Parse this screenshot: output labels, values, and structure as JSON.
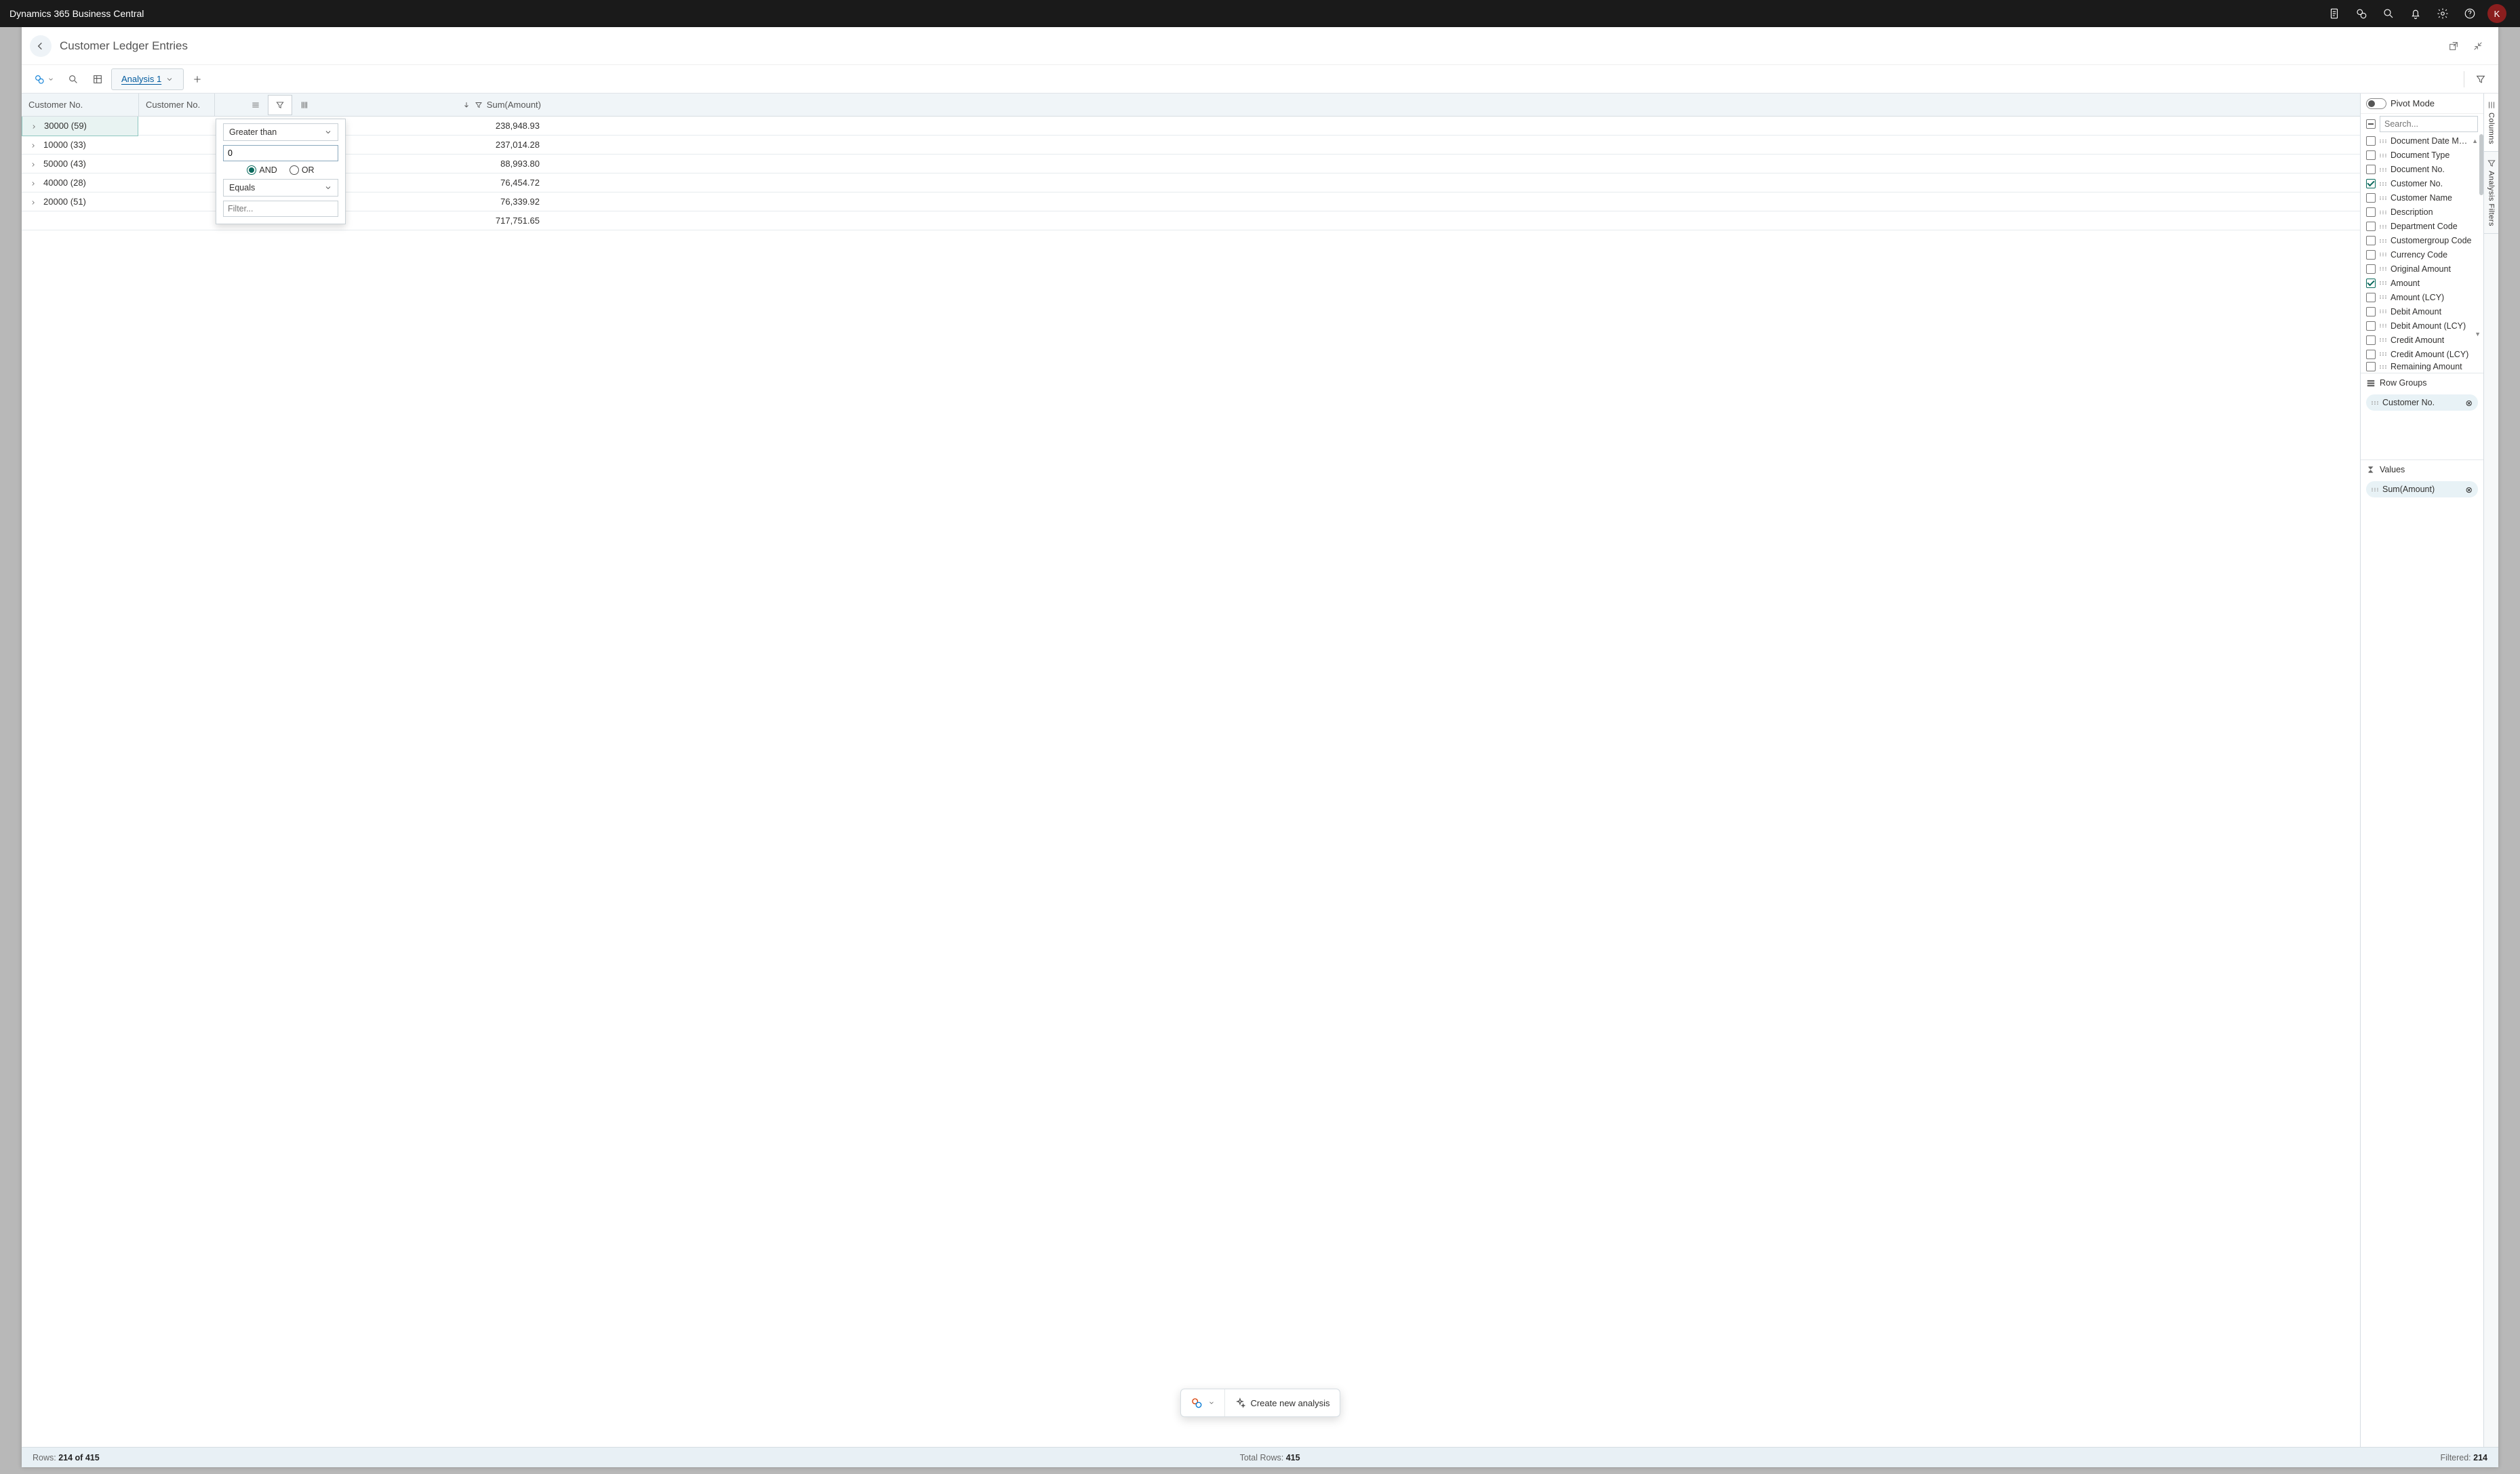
{
  "topbar": {
    "title": "Dynamics 365 Business Central",
    "avatar": "K"
  },
  "page": {
    "title": "Customer Ledger Entries",
    "tab_label": "Analysis 1"
  },
  "grid": {
    "col_customer_no": "Customer No.",
    "col_customer_no2": "Customer No.",
    "col_amount": "Sum(Amount)",
    "rows": [
      {
        "group": "30000",
        "count": "(59)",
        "amount": "238,948.93",
        "selected": true
      },
      {
        "group": "10000",
        "count": "(33)",
        "amount": "237,014.28"
      },
      {
        "group": "50000",
        "count": "(43)",
        "amount": "88,993.80"
      },
      {
        "group": "40000",
        "count": "(28)",
        "amount": "76,454.72"
      },
      {
        "group": "20000",
        "count": "(51)",
        "amount": "76,339.92"
      }
    ],
    "total": "717,751.65"
  },
  "filter_popup": {
    "op1": "Greater than",
    "value1": "0",
    "and": "AND",
    "or": "OR",
    "op2": "Equals",
    "value2_placeholder": "Filter..."
  },
  "side": {
    "pivot_mode": "Pivot Mode",
    "search_placeholder": "Search...",
    "columns": [
      {
        "label": "Document Date Month",
        "checked": false,
        "sort": "▲"
      },
      {
        "label": "Document Type",
        "checked": false
      },
      {
        "label": "Document No.",
        "checked": false
      },
      {
        "label": "Customer No.",
        "checked": true
      },
      {
        "label": "Customer Name",
        "checked": false
      },
      {
        "label": "Description",
        "checked": false
      },
      {
        "label": "Department Code",
        "checked": false
      },
      {
        "label": "Customergroup Code",
        "checked": false
      },
      {
        "label": "Currency Code",
        "checked": false
      },
      {
        "label": "Original Amount",
        "checked": false
      },
      {
        "label": "Amount",
        "checked": true
      },
      {
        "label": "Amount (LCY)",
        "checked": false
      },
      {
        "label": "Debit Amount",
        "checked": false
      },
      {
        "label": "Debit Amount (LCY)",
        "checked": false
      },
      {
        "label": "Credit Amount",
        "checked": false
      },
      {
        "label": "Credit Amount (LCY)",
        "checked": false
      },
      {
        "label": "Remaining Amount",
        "checked": false
      }
    ],
    "row_groups": "Row Groups",
    "row_group_pill": "Customer No.",
    "values": "Values",
    "value_pill": "Sum(Amount)",
    "vtab_columns": "Columns",
    "vtab_filters": "Analysis Filters"
  },
  "fab": {
    "create": "Create new analysis"
  },
  "status": {
    "rows_label": "Rows:",
    "rows_value": "214 of 415",
    "total_label": "Total Rows:",
    "total_value": "415",
    "filtered_label": "Filtered:",
    "filtered_value": "214"
  }
}
